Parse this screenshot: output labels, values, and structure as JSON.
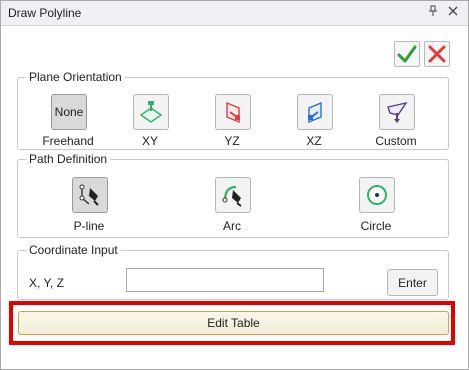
{
  "window": {
    "title": "Draw Polyline",
    "pin_icon": "pin-icon",
    "close_icon": "close-icon"
  },
  "actions": {
    "ok_icon": "checkmark-icon",
    "cancel_icon": "x-icon",
    "ok_color": "#2e9e3a",
    "cancel_color": "#e03a3a"
  },
  "plane_orientation": {
    "label": "Plane Orientation",
    "items": [
      {
        "label": "Freehand",
        "button_text": "None",
        "icon": "none-button",
        "active": true
      },
      {
        "label": "XY",
        "icon": "xy-plane-icon"
      },
      {
        "label": "YZ",
        "icon": "yz-plane-icon"
      },
      {
        "label": "XZ",
        "icon": "xz-plane-icon"
      },
      {
        "label": "Custom",
        "icon": "custom-plane-icon"
      }
    ]
  },
  "path_definition": {
    "label": "Path Definition",
    "items": [
      {
        "label": "P-line",
        "icon": "pline-icon",
        "active": true
      },
      {
        "label": "Arc",
        "icon": "arc-icon"
      },
      {
        "label": "Circle",
        "icon": "circle-icon"
      }
    ]
  },
  "coordinate_input": {
    "label": "Coordinate Input",
    "field_label": "X, Y, Z",
    "value": "",
    "enter_label": "Enter"
  },
  "edit_table": {
    "label": "Edit Table"
  },
  "colors": {
    "highlight": "#e30000",
    "green": "#2db36b",
    "red": "#e04040",
    "blue": "#2a6fd6",
    "purple": "#5a3d8a"
  }
}
